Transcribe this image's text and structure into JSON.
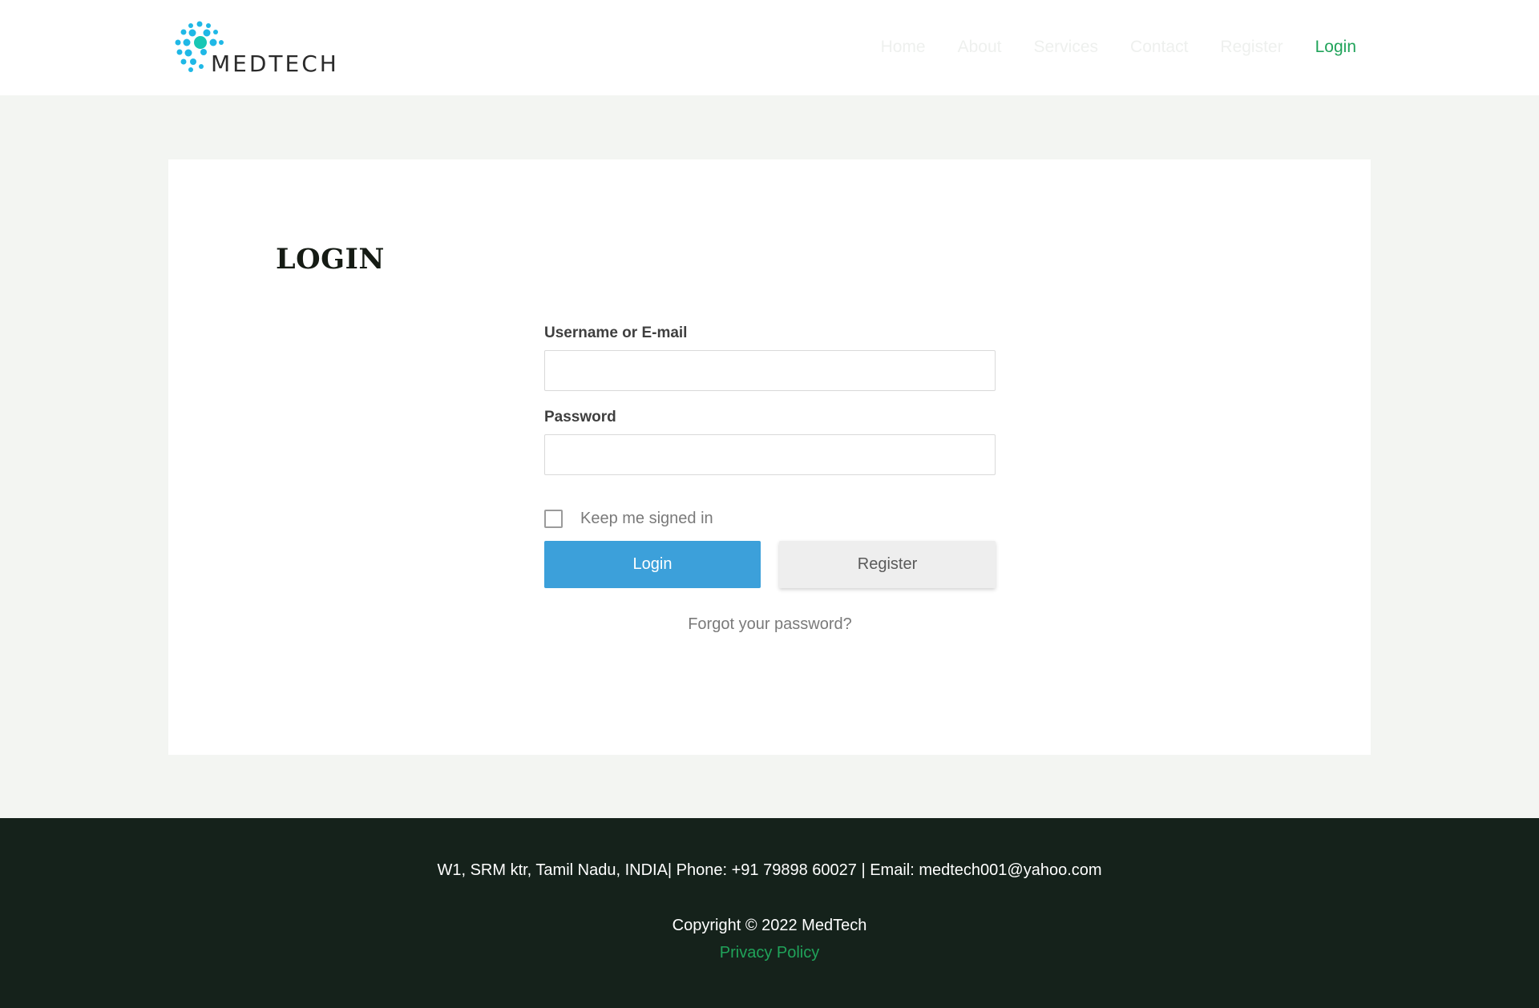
{
  "brand": {
    "name": "MEDTECH",
    "accent_color": "#20a35a",
    "logo_dot_color": "#1fb8e6"
  },
  "nav": {
    "items": [
      {
        "label": "Home"
      },
      {
        "label": "About"
      },
      {
        "label": "Services"
      },
      {
        "label": "Contact"
      },
      {
        "label": "Register"
      },
      {
        "label": "Login",
        "active": true
      }
    ]
  },
  "login": {
    "title": "LOGIN",
    "username_label": "Username or E-mail",
    "username_value": "",
    "password_label": "Password",
    "password_value": "",
    "keep_signed_in_label": "Keep me signed in",
    "keep_signed_in_checked": false,
    "login_button": "Login",
    "register_button": "Register",
    "forgot_link": "Forgot your password?",
    "login_button_color": "#3ca0da"
  },
  "footer": {
    "address": "W1, SRM ktr, Tamil Nadu, INDIA| Phone: +91 79898 60027 | Email: medtech001@yahoo.com",
    "copyright": "Copyright © 2022 MedTech",
    "privacy": "Privacy Policy",
    "background_color": "#15221b"
  }
}
